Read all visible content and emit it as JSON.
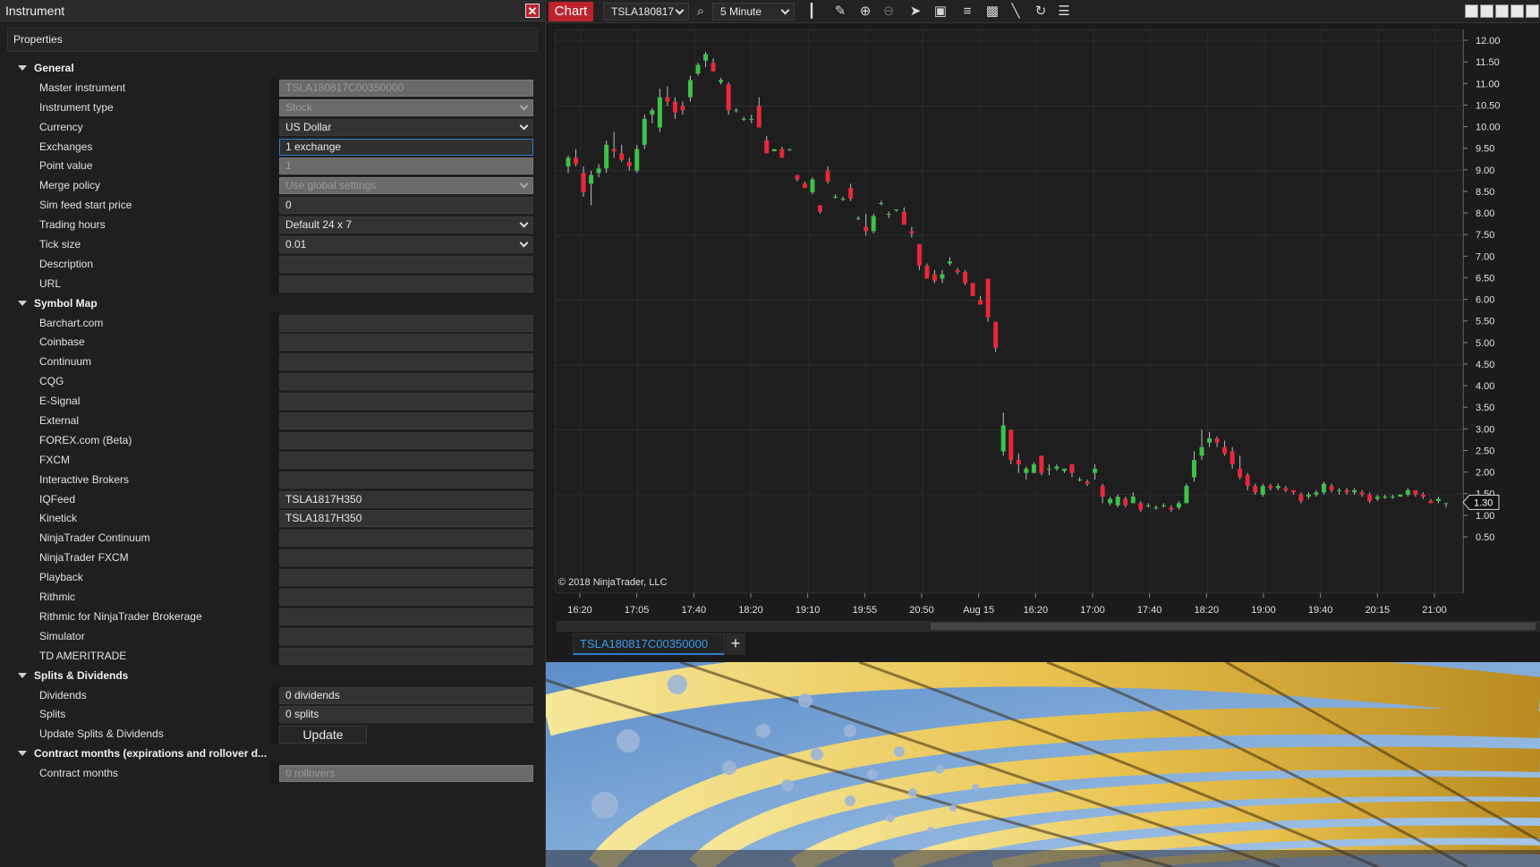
{
  "instrument_window": {
    "title": "Instrument",
    "close_glyph": "✕",
    "properties_label": "Properties",
    "categories": [
      {
        "name": "General",
        "rows": [
          {
            "label": "Master instrument",
            "value": "TSLA180817C00350000",
            "state": "disabled",
            "dropdown": false
          },
          {
            "label": "Instrument type",
            "value": "Stock",
            "state": "disabled",
            "dropdown": true
          },
          {
            "label": "Currency",
            "value": "US Dollar",
            "state": "normal",
            "dropdown": true
          },
          {
            "label": "Exchanges",
            "value": "1 exchange",
            "state": "focused",
            "dropdown": false
          },
          {
            "label": "Point value",
            "value": "1",
            "state": "disabled",
            "dropdown": false
          },
          {
            "label": "Merge policy",
            "value": "Use global settings",
            "state": "disabled",
            "dropdown": true
          },
          {
            "label": "Sim feed start price",
            "value": "0",
            "state": "normal",
            "dropdown": false
          },
          {
            "label": "Trading hours",
            "value": "Default 24 x 7",
            "state": "normal",
            "dropdown": true
          },
          {
            "label": "Tick size",
            "value": "0.01",
            "state": "normal",
            "dropdown": true
          },
          {
            "label": "Description",
            "value": "",
            "state": "normal",
            "dropdown": false
          },
          {
            "label": "URL",
            "value": "",
            "state": "normal",
            "dropdown": false
          }
        ]
      },
      {
        "name": "Symbol Map",
        "rows": [
          {
            "label": "Barchart.com",
            "value": "",
            "state": "normal",
            "dropdown": false
          },
          {
            "label": "Coinbase",
            "value": "",
            "state": "normal",
            "dropdown": false
          },
          {
            "label": "Continuum",
            "value": "",
            "state": "normal",
            "dropdown": false
          },
          {
            "label": "CQG",
            "value": "",
            "state": "normal",
            "dropdown": false
          },
          {
            "label": "E-Signal",
            "value": "",
            "state": "normal",
            "dropdown": false
          },
          {
            "label": "External",
            "value": "",
            "state": "normal",
            "dropdown": false
          },
          {
            "label": "FOREX.com (Beta)",
            "value": "",
            "state": "normal",
            "dropdown": false
          },
          {
            "label": "FXCM",
            "value": "",
            "state": "normal",
            "dropdown": false
          },
          {
            "label": "Interactive Brokers",
            "value": "",
            "state": "normal",
            "dropdown": false
          },
          {
            "label": "IQFeed",
            "value": "TSLA1817H350",
            "state": "normal",
            "dropdown": false
          },
          {
            "label": "Kinetick",
            "value": "TSLA1817H350",
            "state": "normal",
            "dropdown": false
          },
          {
            "label": "NinjaTrader Continuum",
            "value": "",
            "state": "normal",
            "dropdown": false
          },
          {
            "label": "NinjaTrader FXCM",
            "value": "",
            "state": "normal",
            "dropdown": false
          },
          {
            "label": "Playback",
            "value": "",
            "state": "normal",
            "dropdown": false
          },
          {
            "label": "Rithmic",
            "value": "",
            "state": "normal",
            "dropdown": false
          },
          {
            "label": "Rithmic for NinjaTrader Brokerage",
            "value": "",
            "state": "normal",
            "dropdown": false
          },
          {
            "label": "Simulator",
            "value": "",
            "state": "normal",
            "dropdown": false
          },
          {
            "label": "TD AMERITRADE",
            "value": "",
            "state": "normal",
            "dropdown": false
          }
        ]
      },
      {
        "name": "Splits & Dividends",
        "rows": [
          {
            "label": "Dividends",
            "value": "0 dividends",
            "state": "normal",
            "dropdown": false
          },
          {
            "label": "Splits",
            "value": "0 splits",
            "state": "normal",
            "dropdown": false
          },
          {
            "label": "Update Splits & Dividends",
            "value": "Update",
            "state": "button",
            "dropdown": false
          }
        ]
      },
      {
        "name": "Contract months (expirations and rollover d...",
        "rows": [
          {
            "label": "Contract months",
            "value": "0 rollovers",
            "state": "disabled",
            "dropdown": false
          }
        ]
      }
    ]
  },
  "chart_window": {
    "tab_label": "Chart",
    "instrument_select": "TSLA180817",
    "interval_select": "5 Minute",
    "toolbar_icons": [
      "search-icon",
      "bar-type-icon",
      "pencil-draw-icon",
      "zoom-in-icon",
      "zoom-out-icon",
      "pointer-icon",
      "data-box-icon",
      "indicators-icon",
      "strategies-icon",
      "drawing-tools-icon",
      "refresh-icon",
      "properties-list-icon"
    ],
    "copyright": "© 2018 NinjaTrader, LLC",
    "instrument_tab": "TSLA180817C00350000",
    "add_tab_glyph": "+",
    "last_price_label": "1.30"
  },
  "colors": {
    "accent_red": "#c0222b",
    "up_candle": "#3cc24a",
    "down_candle": "#e8283a",
    "focus_blue": "#2d80d0"
  },
  "chart_data": {
    "type": "candlestick",
    "title": "",
    "xlabel": "",
    "ylabel": "",
    "ylim": [
      0.5,
      12.0
    ],
    "y_ticks": [
      "12.00",
      "11.50",
      "11.00",
      "10.50",
      "10.00",
      "9.50",
      "9.00",
      "8.50",
      "8.00",
      "7.50",
      "7.00",
      "6.50",
      "6.00",
      "5.50",
      "5.00",
      "4.50",
      "4.00",
      "3.50",
      "3.00",
      "2.50",
      "2.00",
      "1.50",
      "1.00",
      "0.50"
    ],
    "x_ticks": [
      "16:20",
      "17:05",
      "17:40",
      "18:20",
      "19:10",
      "19:55",
      "20:50",
      "Aug 15",
      "16:20",
      "17:00",
      "17:40",
      "18:20",
      "19:00",
      "19:40",
      "20:15",
      "21:00"
    ],
    "last_price": 1.3,
    "candles": [
      [
        9.1,
        9.35,
        8.95,
        9.3
      ],
      [
        9.3,
        9.5,
        9.1,
        9.15
      ],
      [
        8.95,
        9.1,
        8.4,
        8.5
      ],
      [
        8.7,
        9.0,
        8.2,
        8.9
      ],
      [
        8.95,
        9.15,
        8.85,
        9.05
      ],
      [
        9.05,
        9.7,
        8.95,
        9.6
      ],
      [
        9.5,
        9.9,
        9.3,
        9.45
      ],
      [
        9.4,
        9.6,
        9.2,
        9.25
      ],
      [
        9.2,
        9.3,
        9.0,
        9.1
      ],
      [
        9.0,
        9.6,
        8.95,
        9.5
      ],
      [
        9.6,
        10.3,
        9.5,
        10.2
      ],
      [
        10.3,
        10.45,
        10.1,
        10.4
      ],
      [
        10.0,
        10.9,
        9.9,
        10.7
      ],
      [
        10.7,
        10.95,
        10.5,
        10.6
      ],
      [
        10.6,
        10.7,
        10.2,
        10.35
      ],
      [
        10.5,
        10.6,
        10.3,
        10.4
      ],
      [
        10.7,
        11.2,
        10.6,
        11.1
      ],
      [
        11.25,
        11.5,
        11.2,
        11.45
      ],
      [
        11.55,
        11.75,
        11.4,
        11.7
      ],
      [
        11.5,
        11.6,
        11.3,
        11.3
      ],
      [
        11.05,
        11.15,
        11.0,
        11.1
      ],
      [
        11.0,
        11.05,
        10.3,
        10.4
      ],
      [
        10.4,
        10.45,
        10.35,
        10.4
      ],
      [
        10.2,
        10.25,
        10.15,
        10.2
      ],
      [
        10.2,
        10.3,
        10.1,
        10.2
      ],
      [
        10.5,
        10.7,
        10.1,
        10.0
      ],
      [
        9.7,
        9.8,
        9.4,
        9.4
      ],
      [
        9.45,
        9.5,
        9.45,
        9.5
      ],
      [
        9.5,
        9.55,
        9.3,
        9.3
      ],
      [
        9.5,
        9.5,
        9.45,
        9.5
      ],
      [
        8.9,
        8.9,
        8.75,
        8.8
      ],
      [
        8.7,
        8.75,
        8.6,
        8.6
      ],
      [
        8.5,
        8.85,
        8.45,
        8.8
      ],
      [
        8.2,
        8.2,
        8.0,
        8.05
      ],
      [
        9.0,
        9.1,
        8.7,
        8.75
      ],
      [
        8.4,
        8.45,
        8.35,
        8.4
      ],
      [
        8.35,
        8.4,
        8.3,
        8.35
      ],
      [
        8.6,
        8.7,
        8.3,
        8.35
      ],
      [
        7.9,
        7.95,
        7.85,
        7.9
      ],
      [
        7.7,
        8.0,
        7.5,
        7.6
      ],
      [
        7.6,
        8.0,
        7.55,
        7.95
      ],
      [
        8.25,
        8.3,
        8.2,
        8.25
      ],
      [
        8.0,
        8.05,
        7.9,
        8.0
      ],
      [
        8.1,
        8.1,
        8.05,
        8.1
      ],
      [
        8.05,
        8.15,
        7.75,
        7.75
      ],
      [
        7.6,
        7.7,
        7.45,
        7.55
      ],
      [
        7.3,
        7.3,
        6.7,
        6.8
      ],
      [
        6.8,
        6.85,
        6.5,
        6.5
      ],
      [
        6.6,
        6.7,
        6.4,
        6.45
      ],
      [
        6.5,
        6.7,
        6.4,
        6.6
      ],
      [
        6.85,
        7.0,
        6.8,
        6.9
      ],
      [
        6.7,
        6.75,
        6.6,
        6.65
      ],
      [
        6.65,
        6.7,
        6.35,
        6.4
      ],
      [
        6.4,
        6.4,
        6.1,
        6.1
      ],
      [
        6.0,
        6.1,
        5.9,
        5.9
      ],
      [
        6.5,
        6.5,
        5.5,
        5.6
      ],
      [
        5.5,
        5.5,
        4.8,
        4.9
      ],
      [
        2.5,
        3.4,
        2.4,
        3.1
      ],
      [
        3.0,
        3.0,
        2.2,
        2.3
      ],
      [
        2.3,
        2.45,
        2.0,
        2.2
      ],
      [
        2.0,
        2.15,
        1.85,
        2.1
      ],
      [
        2.0,
        2.25,
        2.0,
        2.2
      ],
      [
        2.4,
        2.4,
        1.95,
        2.0
      ],
      [
        2.1,
        2.2,
        1.95,
        2.1
      ],
      [
        2.1,
        2.2,
        2.05,
        2.15
      ],
      [
        2.05,
        2.1,
        2.0,
        2.1
      ],
      [
        2.2,
        2.2,
        1.9,
        2.0
      ],
      [
        1.85,
        1.9,
        1.8,
        1.85
      ],
      [
        1.8,
        1.85,
        1.7,
        1.75
      ],
      [
        2.0,
        2.2,
        1.85,
        2.1
      ],
      [
        1.7,
        1.75,
        1.3,
        1.45
      ],
      [
        1.3,
        1.45,
        1.25,
        1.4
      ],
      [
        1.25,
        1.5,
        1.2,
        1.45
      ],
      [
        1.4,
        1.45,
        1.2,
        1.25
      ],
      [
        1.3,
        1.55,
        1.3,
        1.45
      ],
      [
        1.3,
        1.35,
        1.1,
        1.15
      ],
      [
        1.25,
        1.3,
        1.2,
        1.25
      ],
      [
        1.2,
        1.25,
        1.15,
        1.2
      ],
      [
        1.25,
        1.3,
        1.2,
        1.25
      ],
      [
        1.2,
        1.25,
        1.1,
        1.15
      ],
      [
        1.2,
        1.35,
        1.15,
        1.3
      ],
      [
        1.3,
        1.75,
        1.3,
        1.7
      ],
      [
        1.9,
        2.5,
        1.8,
        2.3
      ],
      [
        2.4,
        3.0,
        2.3,
        2.6
      ],
      [
        2.7,
        2.95,
        2.6,
        2.8
      ],
      [
        2.8,
        2.85,
        2.6,
        2.7
      ],
      [
        2.6,
        2.75,
        2.4,
        2.45
      ],
      [
        2.5,
        2.6,
        2.1,
        2.2
      ],
      [
        2.1,
        2.4,
        1.85,
        1.9
      ],
      [
        1.95,
        2.0,
        1.6,
        1.7
      ],
      [
        1.7,
        1.75,
        1.5,
        1.55
      ],
      [
        1.5,
        1.75,
        1.45,
        1.7
      ],
      [
        1.7,
        1.75,
        1.6,
        1.65
      ],
      [
        1.65,
        1.75,
        1.6,
        1.7
      ],
      [
        1.65,
        1.7,
        1.55,
        1.6
      ],
      [
        1.6,
        1.6,
        1.5,
        1.55
      ],
      [
        1.5,
        1.55,
        1.3,
        1.35
      ],
      [
        1.45,
        1.55,
        1.4,
        1.5
      ],
      [
        1.5,
        1.6,
        1.45,
        1.55
      ],
      [
        1.55,
        1.8,
        1.5,
        1.75
      ],
      [
        1.7,
        1.75,
        1.55,
        1.6
      ],
      [
        1.6,
        1.65,
        1.5,
        1.6
      ],
      [
        1.6,
        1.65,
        1.5,
        1.55
      ],
      [
        1.55,
        1.65,
        1.5,
        1.6
      ],
      [
        1.55,
        1.6,
        1.45,
        1.5
      ],
      [
        1.5,
        1.55,
        1.3,
        1.35
      ],
      [
        1.4,
        1.5,
        1.35,
        1.45
      ],
      [
        1.45,
        1.5,
        1.4,
        1.45
      ],
      [
        1.45,
        1.5,
        1.4,
        1.45
      ],
      [
        1.45,
        1.5,
        1.45,
        1.5
      ],
      [
        1.5,
        1.65,
        1.45,
        1.6
      ],
      [
        1.6,
        1.6,
        1.45,
        1.5
      ],
      [
        1.5,
        1.55,
        1.4,
        1.45
      ],
      [
        1.35,
        1.4,
        1.3,
        1.3
      ],
      [
        1.35,
        1.45,
        1.3,
        1.4
      ],
      [
        1.3,
        1.3,
        1.2,
        1.3
      ]
    ]
  },
  "photo": {
    "subject": "yellow-lattice-tunnel-photo"
  }
}
